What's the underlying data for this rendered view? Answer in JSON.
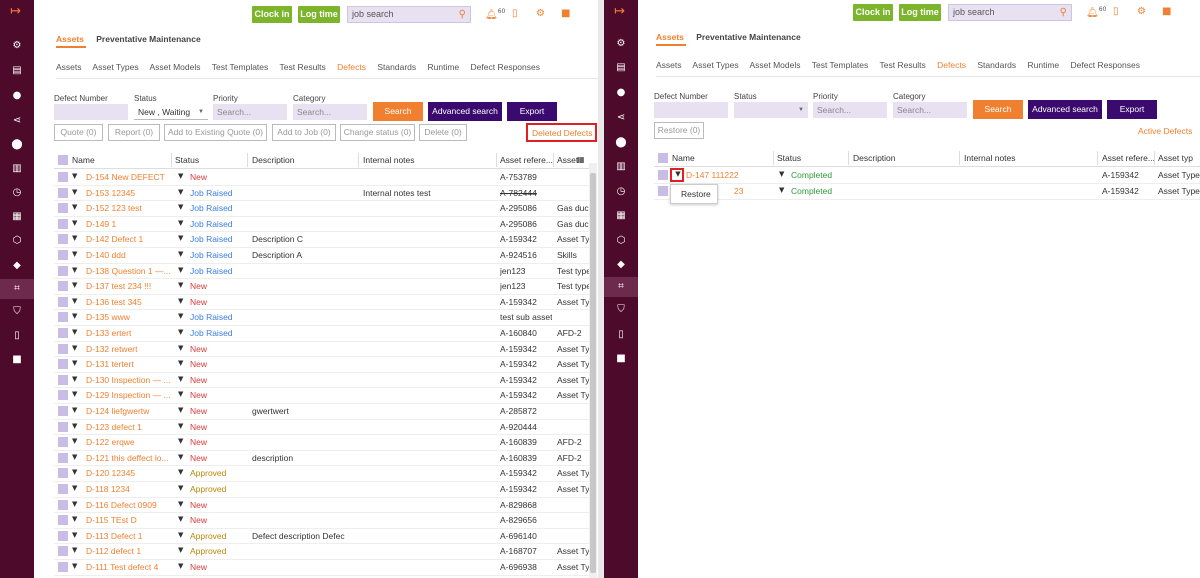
{
  "app": {
    "clock_in": "Clock in",
    "log_time": "Log time",
    "search_placeholder": "job search",
    "notif_count": "60",
    "top_tabs": [
      "Assets",
      "Preventative Maintenance"
    ],
    "sub_tabs": [
      "Assets",
      "Asset Types",
      "Asset Models",
      "Test Templates",
      "Test Results",
      "Defects",
      "Standards",
      "Runtime",
      "Defect Responses"
    ],
    "active_sub_tab": "Defects",
    "colors": {
      "sidebar": "#4d0a2b",
      "accent": "#f08030",
      "green": "#7cb52b",
      "purple": "#3b0a6e"
    }
  },
  "filters": {
    "defect_number_label": "Defect Number",
    "status_label": "Status",
    "priority_label": "Priority",
    "category_label": "Category",
    "status_value_left": "New , Waiting",
    "priority_placeholder": "Search...",
    "category_placeholder": "Search...",
    "search_btn": "Search",
    "advanced_btn": "Advanced search",
    "export_btn": "Export"
  },
  "left": {
    "actions": [
      "Quote (0)",
      "Report (0)",
      "Add to Existing Quote (0)",
      "Add to Job (0)",
      "Change status (0)",
      "Delete (0)"
    ],
    "deleted_link": "Deleted Defects",
    "columns": [
      "Name",
      "Status",
      "Description",
      "Internal notes",
      "Asset refere...",
      "Asset"
    ],
    "rows": [
      {
        "name": "D-154 New DEFECT",
        "status": "New",
        "desc": "",
        "notes": "",
        "asset": "A-753789",
        "type": "",
        "strike": false
      },
      {
        "name": "D-153 12345",
        "status": "Job Raised",
        "desc": "",
        "notes": "Internal notes test",
        "asset": "A-782444",
        "type": "",
        "strike": true
      },
      {
        "name": "D-152 123 test",
        "status": "Job Raised",
        "desc": "",
        "notes": "",
        "asset": "A-295086",
        "type": "Gas duc",
        "strike": false
      },
      {
        "name": "D-149 1",
        "status": "Job Raised",
        "desc": "",
        "notes": "",
        "asset": "A-295086",
        "type": "Gas duc",
        "strike": false
      },
      {
        "name": "D-142 Defect 1",
        "status": "Job Raised",
        "desc": "Description C",
        "notes": "",
        "asset": "A-159342",
        "type": "Asset Typ",
        "strike": false
      },
      {
        "name": "D-140 ddd",
        "status": "Job Raised",
        "desc": "Description A",
        "notes": "",
        "asset": "A-924516",
        "type": "Skills",
        "strike": false
      },
      {
        "name": "D-138 Question 1 —...",
        "status": "Job Raised",
        "desc": "",
        "notes": "",
        "asset": "jen123",
        "type": "Test type",
        "strike": false
      },
      {
        "name": "D-137 test 234 !!!",
        "status": "New",
        "desc": "",
        "notes": "",
        "asset": "jen123",
        "type": "Test type",
        "strike": false
      },
      {
        "name": "D-136 test 345",
        "status": "New",
        "desc": "",
        "notes": "",
        "asset": "A-159342",
        "type": "Asset Typ",
        "strike": false
      },
      {
        "name": "D-135 www",
        "status": "Job Raised",
        "desc": "",
        "notes": "",
        "asset": "test sub asset",
        "type": "",
        "strike": false
      },
      {
        "name": "D-133 ertert",
        "status": "Job Raised",
        "desc": "",
        "notes": "",
        "asset": "A-160840",
        "type": "AFD-2",
        "strike": false
      },
      {
        "name": "D-132 retwert",
        "status": "New",
        "desc": "",
        "notes": "",
        "asset": "A-159342",
        "type": "Asset Typ",
        "strike": false
      },
      {
        "name": "D-131 tertert",
        "status": "New",
        "desc": "",
        "notes": "",
        "asset": "A-159342",
        "type": "Asset Typ",
        "strike": false
      },
      {
        "name": "D-130 Inspection — ...",
        "status": "New",
        "desc": "",
        "notes": "",
        "asset": "A-159342",
        "type": "Asset Typ",
        "strike": false
      },
      {
        "name": "D-129 Inspection — ...",
        "status": "New",
        "desc": "",
        "notes": "",
        "asset": "A-159342",
        "type": "Asset Typ",
        "strike": false
      },
      {
        "name": "D-124 liefgwertw",
        "status": "New",
        "desc": "gwertwert",
        "notes": "",
        "asset": "A-285872",
        "type": "",
        "strike": false
      },
      {
        "name": "D-123 defect 1",
        "status": "New",
        "desc": "",
        "notes": "",
        "asset": "A-920444",
        "type": "",
        "strike": false
      },
      {
        "name": "D-122 erqwe",
        "status": "New",
        "desc": "",
        "notes": "",
        "asset": "A-160839",
        "type": "AFD-2",
        "strike": false
      },
      {
        "name": "D-121 this deffect lo...",
        "status": "New",
        "desc": "description",
        "notes": "",
        "asset": "A-160839",
        "type": "AFD-2",
        "strike": false
      },
      {
        "name": "D-120 12345",
        "status": "Approved",
        "desc": "",
        "notes": "",
        "asset": "A-159342",
        "type": "Asset Typ",
        "strike": false
      },
      {
        "name": "D-118 1234",
        "status": "Approved",
        "desc": "",
        "notes": "",
        "asset": "A-159342",
        "type": "Asset Typ",
        "strike": false
      },
      {
        "name": "D-116 Defect 0909",
        "status": "New",
        "desc": "",
        "notes": "",
        "asset": "A-829868",
        "type": "",
        "strike": false
      },
      {
        "name": "D-115 TEst D",
        "status": "New",
        "desc": "",
        "notes": "",
        "asset": "A-829656",
        "type": "",
        "strike": false
      },
      {
        "name": "D-113 Defect 1",
        "status": "Approved",
        "desc": "Defect description Defec",
        "notes": "",
        "asset": "A-696140",
        "type": "",
        "strike": false
      },
      {
        "name": "D-112 defect 1",
        "status": "Approved",
        "desc": "",
        "notes": "",
        "asset": "A-168707",
        "type": "Asset Typ",
        "strike": false
      },
      {
        "name": "D-111 Test defect 4",
        "status": "New",
        "desc": "",
        "notes": "",
        "asset": "A-696938",
        "type": "Asset Typ",
        "strike": false
      }
    ]
  },
  "right": {
    "restore_btn": "Restore (0)",
    "active_link": "Active Defects",
    "columns": [
      "Name",
      "Status",
      "Description",
      "Internal notes",
      "Asset refere...",
      "Asset typ"
    ],
    "rows": [
      {
        "name": "D-147 111222",
        "status": "Completed",
        "asset": "A-159342",
        "type": "Asset Type"
      },
      {
        "name": "23",
        "status": "Completed",
        "asset": "A-159342",
        "type": "Asset Type"
      }
    ],
    "popup_item": "Restore"
  }
}
